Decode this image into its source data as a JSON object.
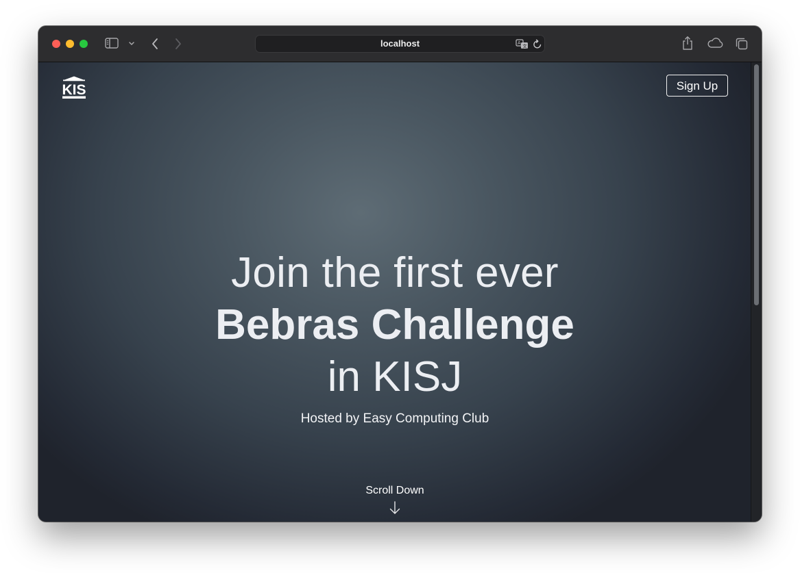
{
  "browser": {
    "address": "localhost",
    "icons": {
      "sidebar": "sidebar-icon",
      "chevron": "chevron-down-icon",
      "back": "back-arrow-icon",
      "forward": "forward-arrow-icon",
      "translate": "translate-icon",
      "reload": "reload-icon",
      "share": "share-icon",
      "icloud": "cloud-icon",
      "tabs": "tab-overview-icon"
    }
  },
  "page": {
    "logo_text": "KIS",
    "signup_label": "Sign Up",
    "hero": {
      "line1": "Join the first ever",
      "line2": "Bebras Challenge",
      "line3": "in KISJ",
      "subtitle": "Hosted by Easy Computing Club"
    },
    "scroll_label": "Scroll Down"
  },
  "colors": {
    "background_center": "#5e6c75",
    "background_edge": "#1f232c",
    "text": "#eceef2"
  }
}
